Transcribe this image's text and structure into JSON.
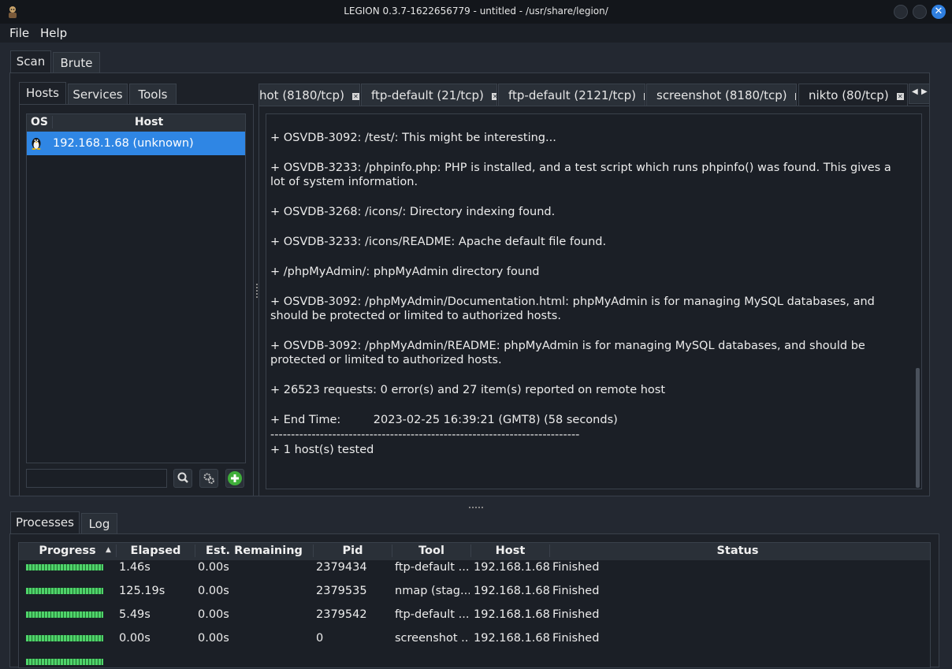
{
  "window": {
    "title": "LEGION 0.3.7-1622656779 - untitled - /usr/share/legion/"
  },
  "menu": [
    "File",
    "Help"
  ],
  "main_tabs": [
    "Scan",
    "Brute"
  ],
  "left_tabs": [
    "Hosts",
    "Services",
    "Tools"
  ],
  "hosts": {
    "columns": [
      "OS",
      "Host"
    ],
    "rows": [
      {
        "os_icon": "linux-penguin-icon",
        "host": "192.168.1.68 (unknown)"
      }
    ],
    "filter_placeholder": ""
  },
  "tool_tabs": [
    "hot (8180/tcp)",
    "ftp-default (21/tcp)",
    "ftp-default (2121/tcp)",
    "screenshot (8180/tcp)",
    "nikto (80/tcp)"
  ],
  "output_lines": [
    "+ OSVDB-3092: /test/: This might be interesting...",
    "+ OSVDB-3233: /phpinfo.php: PHP is installed, and a test script which runs phpinfo() was found. This gives a lot of system information.",
    "+ OSVDB-3268: /icons/: Directory indexing found.",
    "+ OSVDB-3233: /icons/README: Apache default file found.",
    "+ /phpMyAdmin/: phpMyAdmin directory found",
    "+ OSVDB-3092: /phpMyAdmin/Documentation.html: phpMyAdmin is for managing MySQL databases, and should be protected or limited to authorized hosts.",
    "+ OSVDB-3092: /phpMyAdmin/README: phpMyAdmin is for managing MySQL databases, and should be protected or limited to authorized hosts.",
    "+ 26523 requests: 0 error(s) and 27 item(s) reported on remote host",
    "+ End Time:         2023-02-25 16:39:21 (GMT8) (58 seconds)",
    "---------------------------------------------------------------------------",
    "+ 1 host(s) tested"
  ],
  "bottom_tabs": [
    "Processes",
    "Log"
  ],
  "processes": {
    "columns": [
      "Progress",
      "Elapsed",
      "Est. Remaining",
      "Pid",
      "Tool",
      "Host",
      "Status"
    ],
    "rows": [
      {
        "progress": 1.0,
        "elapsed": "1.46s",
        "remaining": "0.00s",
        "pid": "2379434",
        "tool": "ftp-default ...",
        "host": "192.168.1.68",
        "status": "Finished"
      },
      {
        "progress": 1.0,
        "elapsed": "125.19s",
        "remaining": "0.00s",
        "pid": "2379535",
        "tool": "nmap (stag...",
        "host": "192.168.1.68",
        "status": "Finished"
      },
      {
        "progress": 1.0,
        "elapsed": "5.49s",
        "remaining": "0.00s",
        "pid": "2379542",
        "tool": "ftp-default ...",
        "host": "192.168.1.68",
        "status": "Finished"
      },
      {
        "progress": 1.0,
        "elapsed": "0.00s",
        "remaining": "0.00s",
        "pid": "0",
        "tool": "screenshot ...",
        "host": "192.168.1.68",
        "status": "Finished"
      }
    ]
  },
  "colors": {
    "accent": "#2f86e4",
    "progress": "#4fd36a",
    "background": "#232831"
  }
}
